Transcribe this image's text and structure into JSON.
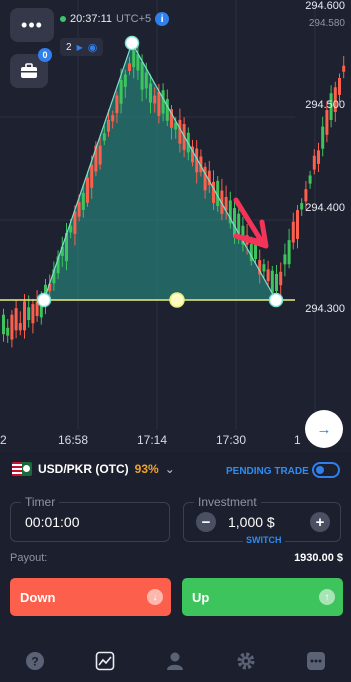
{
  "header": {
    "time": "20:37:11",
    "timezone": "UTC+5",
    "drawings_count": "2",
    "portfolio_badge": "0"
  },
  "chart": {
    "price_labels": [
      "294.600",
      "294.580",
      "294.500",
      "294.400",
      "294.300"
    ],
    "time_labels": [
      "2",
      "16:58",
      "17:14",
      "17:30",
      "1"
    ],
    "colors": {
      "bull": "#3ec45c",
      "bear": "#fc5f4b",
      "area": "#2bb3a0",
      "guide": "#e9ef7b"
    }
  },
  "asset": {
    "name": "USD/PKR (OTC)",
    "payout_percent": "93%"
  },
  "pending_trade": {
    "label": "PENDING TRADE"
  },
  "timer": {
    "label": "Timer",
    "value": "00:01:00"
  },
  "investment": {
    "label": "Investment",
    "value": "1,000 $",
    "switch_label": "SWITCH"
  },
  "payout": {
    "label": "Payout:",
    "value": "1930.00 $"
  },
  "buttons": {
    "down": "Down",
    "up": "Up"
  },
  "icons": {
    "menu": "menu-dots-icon",
    "portfolio": "briefcase-icon",
    "info": "info-icon",
    "visibility": "eye-icon",
    "scroll": "arrow-right-icon",
    "help": "question-icon",
    "chart": "chart-icon",
    "profile": "user-icon",
    "settings": "gear-icon",
    "more": "more-dots-icon"
  }
}
